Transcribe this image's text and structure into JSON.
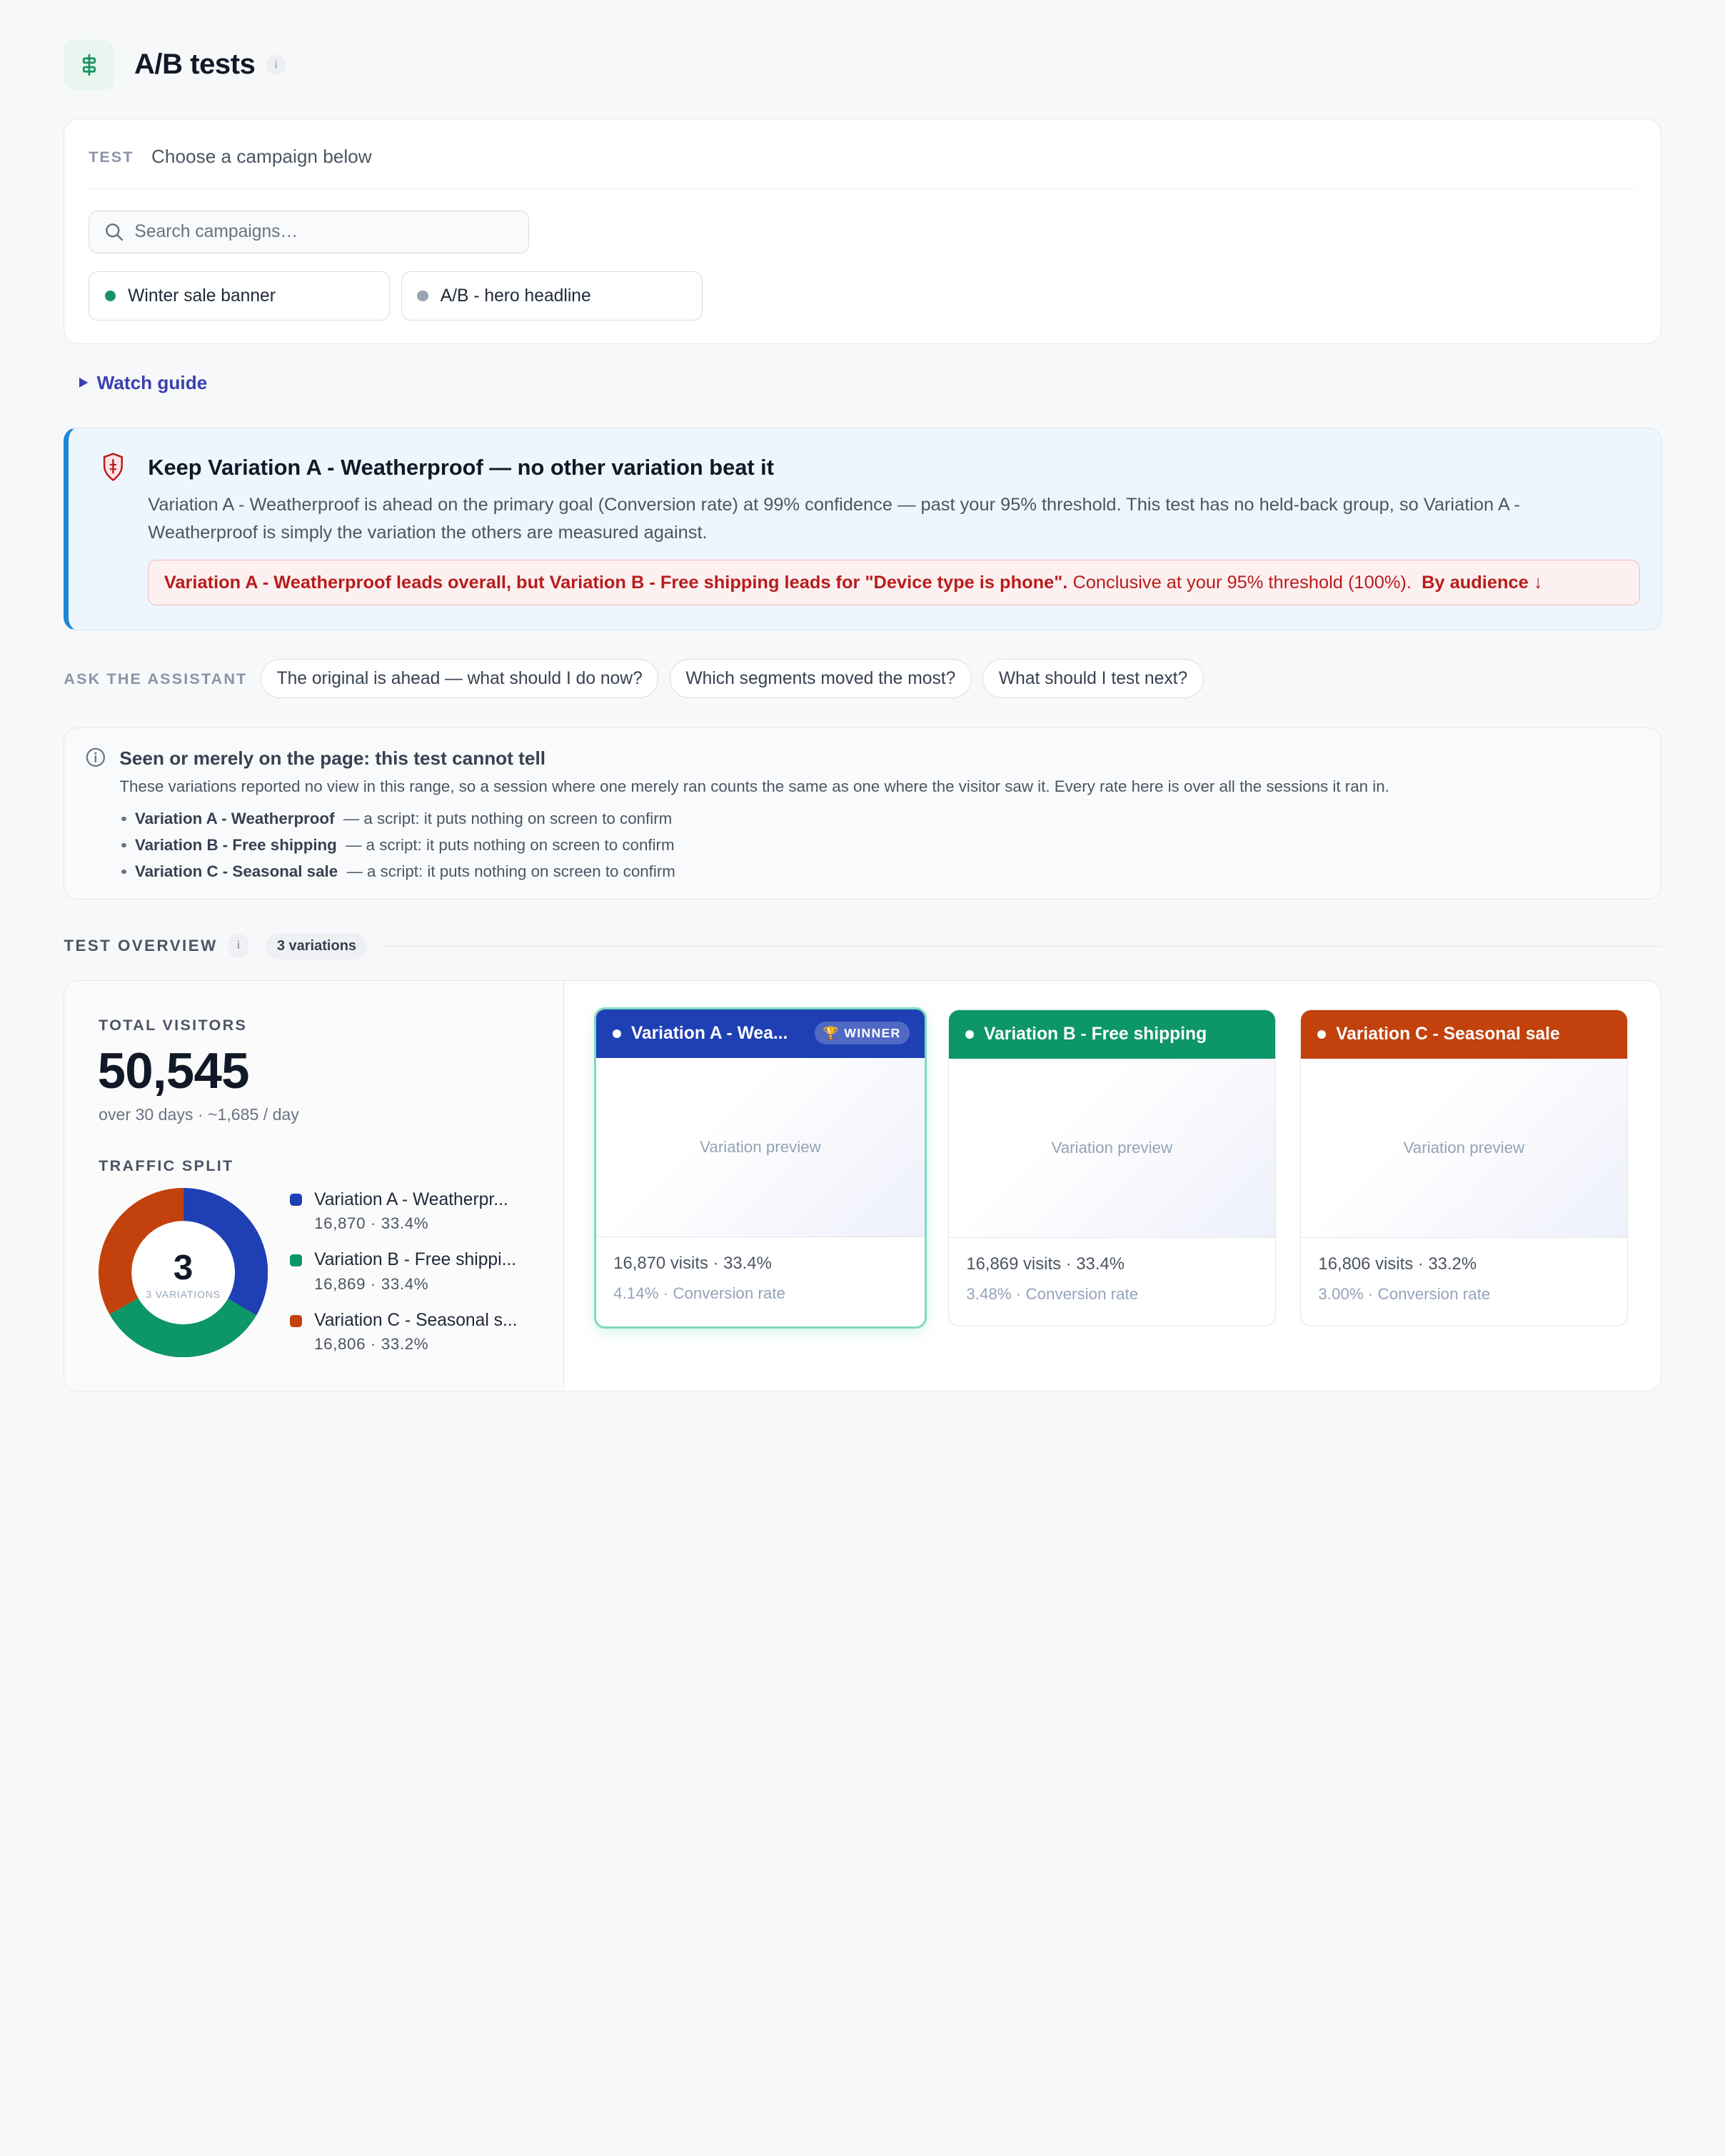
{
  "page": {
    "title": "A/B tests",
    "info": "i"
  },
  "test_picker": {
    "label": "TEST",
    "value": "Choose a campaign below",
    "search_placeholder": "Search campaigns…",
    "campaigns": [
      {
        "name": "Winter sale banner",
        "status_color": "#15945f"
      },
      {
        "name": "A/B - hero headline",
        "status_color": "#9aa3b1"
      }
    ]
  },
  "watch_guide": "Watch guide",
  "recommendation": {
    "title": "Keep Variation A - Weatherproof — no other variation beat it",
    "body": "Variation A - Weatherproof is ahead on the primary goal (Conversion rate) at 99% confidence — past your 95% threshold. This test has no held-back group, so Variation A - Weatherproof is simply the variation the others are measured against.",
    "warning_bold": "Variation A - Weatherproof leads overall, but Variation B - Free shipping leads for \"Device type is phone\".",
    "warning_text": "Conclusive at your 95% threshold (100%).",
    "warning_link": "By audience ↓"
  },
  "assistant": {
    "label": "ASK THE ASSISTANT",
    "prompts": [
      "The original is ahead — what should I do now?",
      "Which segments moved the most?",
      "What should I test next?"
    ]
  },
  "seen_notice": {
    "title": "Seen or merely on the page: this test cannot tell",
    "body": "These variations reported no view in this range, so a session where one merely ran counts the same as one where the visitor saw it. Every rate here is over all the sessions it ran in.",
    "items": [
      {
        "name": "Variation A - Weatherproof",
        "detail": "— a script: it puts nothing on screen to confirm"
      },
      {
        "name": "Variation B - Free shipping",
        "detail": "— a script: it puts nothing on screen to confirm"
      },
      {
        "name": "Variation C - Seasonal sale",
        "detail": "— a script: it puts nothing on screen to confirm"
      }
    ]
  },
  "overview": {
    "label": "TEST OVERVIEW",
    "info": "i",
    "badge": "3 variations",
    "total_label": "TOTAL VISITORS",
    "total_value": "50,545",
    "total_sub": "over 30 days · ~1,685 / day",
    "split_label": "TRAFFIC SPLIT",
    "donut_center": "3",
    "donut_center_sub": "3 VARIATIONS",
    "legend": [
      {
        "name": "Variation A - Weatherpr...",
        "stat": "16,870 · 33.4%",
        "color": "#1f3fb5"
      },
      {
        "name": "Variation B - Free shippi...",
        "stat": "16,869 · 33.4%",
        "color": "#0d9668"
      },
      {
        "name": "Variation C - Seasonal s...",
        "stat": "16,806 · 33.2%",
        "color": "#c2410c"
      }
    ],
    "variations": [
      {
        "name": "Variation A - Wea...",
        "color": "#1f3fb5",
        "winner": "WINNER",
        "preview": "Variation preview",
        "visits": "16,870 visits · 33.4%",
        "rate": "4.14% · Conversion rate",
        "share": 33.4
      },
      {
        "name": "Variation B - Free shipping",
        "color": "#0d9668",
        "preview": "Variation preview",
        "visits": "16,869 visits · 33.4%",
        "rate": "3.48% · Conversion rate",
        "share": 33.4
      },
      {
        "name": "Variation C - Seasonal sale",
        "color": "#c2410c",
        "preview": "Variation preview",
        "visits": "16,806 visits · 33.2%",
        "rate": "3.00% · Conversion rate",
        "share": 33.2
      }
    ]
  }
}
